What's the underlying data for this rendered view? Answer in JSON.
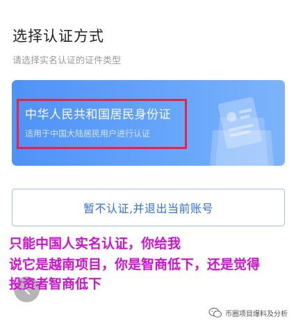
{
  "page": {
    "title": "选择认证方式",
    "subtitle": "请选择实名认证的证件类型"
  },
  "id_card_option": {
    "title": "中华人民共和国居民身份证",
    "description": "适用于中国大陆居民用户进行认证",
    "highlight_color": "#e8243a",
    "accent_color": "#4f92f8"
  },
  "skip_button": {
    "label": "暂不认证,并退出当前账号"
  },
  "annotation": {
    "color": "#d40fd4",
    "lines": [
      "只能中国人实名认证，你给我",
      "说它是越南项目，你是智商低下，还是觉得",
      "投资者智商低下"
    ]
  },
  "icons": {
    "back": "back-arrow-icon",
    "id_card": "id-card-icon",
    "watermark": "wechat-icon"
  },
  "watermark": {
    "text": "币圈项目爆料及分析"
  }
}
